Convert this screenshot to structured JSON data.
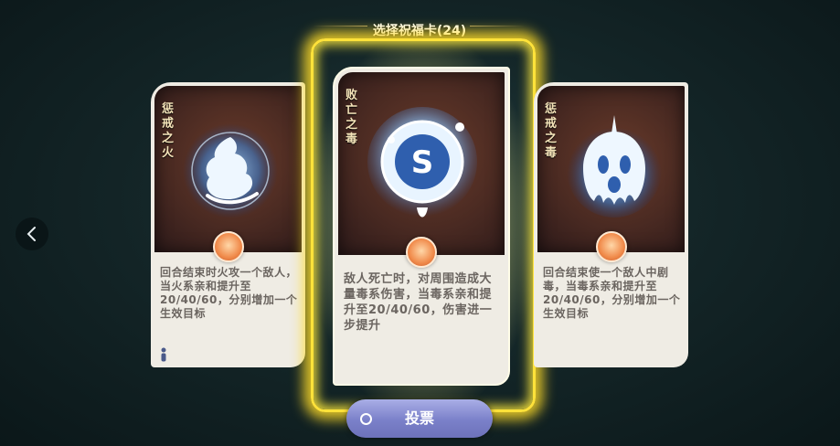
{
  "header": {
    "title": "选择祝福卡(24)"
  },
  "navigation": {
    "prev_label": "‹"
  },
  "cards": [
    {
      "name": "惩戒之火",
      "description": "回合结束时火攻一个敌人，当火系亲和提升至20/40/60，分别增加一个生效目标",
      "icon": "fire-spirit-icon",
      "selected": false
    },
    {
      "name": "败亡之毒",
      "description": "敌人死亡时，对周围造成大量毒系伤害，当毒系亲和提升至20/40/60，伤害进一步提升",
      "icon": "poison-bubble-icon",
      "selected": true
    },
    {
      "name": "惩戒之毒",
      "description": "回合结束使一个敌人中剧毒，当毒系亲和提升至20/40/60，分别增加一个生效目标",
      "icon": "poison-ghost-icon",
      "selected": false
    }
  ],
  "actions": {
    "vote_label": "投票"
  },
  "colors": {
    "selection_glow": "#ffe23a",
    "vote_button": "#7a80c9",
    "card_face": "#efece4",
    "art_background": "#4a2a22",
    "card_name": "#f3e3b8",
    "description_text": "#6b6560"
  }
}
